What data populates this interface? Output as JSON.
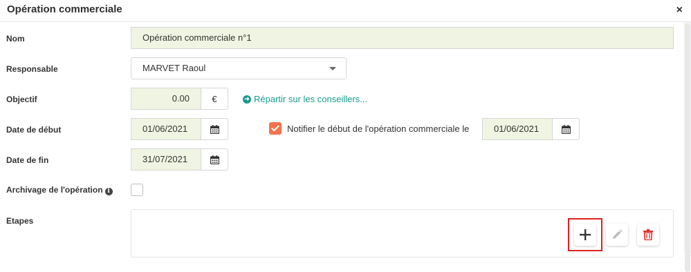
{
  "dialog": {
    "title": "Opération commerciale",
    "close_glyph": "×"
  },
  "fields": {
    "nom": {
      "label": "Nom",
      "value": "Opération commerciale n°1"
    },
    "responsable": {
      "label": "Responsable",
      "value": "MARVET Raoul"
    },
    "objectif": {
      "label": "Objectif",
      "value": "0.00",
      "currency": "€",
      "link": "Répartir sur les conseillers..."
    },
    "date_debut": {
      "label": "Date de début",
      "value": "01/06/2021",
      "notify_label": "Notifier le début de l'opération commerciale le",
      "notify_checked": true,
      "notify_date": "01/06/2021"
    },
    "date_fin": {
      "label": "Date de fin",
      "value": "31/07/2021"
    },
    "archivage": {
      "label": "Archivage de l'opération",
      "info_glyph": "i",
      "checked": false
    },
    "etapes": {
      "label": "Etapes"
    }
  },
  "colors": {
    "accent": "#f4724f",
    "link": "#1a9a8c",
    "field_bg": "#eff5e2",
    "delete": "#e0302a",
    "highlight": "#e02020"
  },
  "icons": [
    "close-icon",
    "caret-down-icon",
    "arrow-circle-right-icon",
    "calendar-icon",
    "info-icon",
    "plus-icon",
    "pencil-icon",
    "trash-icon"
  ]
}
